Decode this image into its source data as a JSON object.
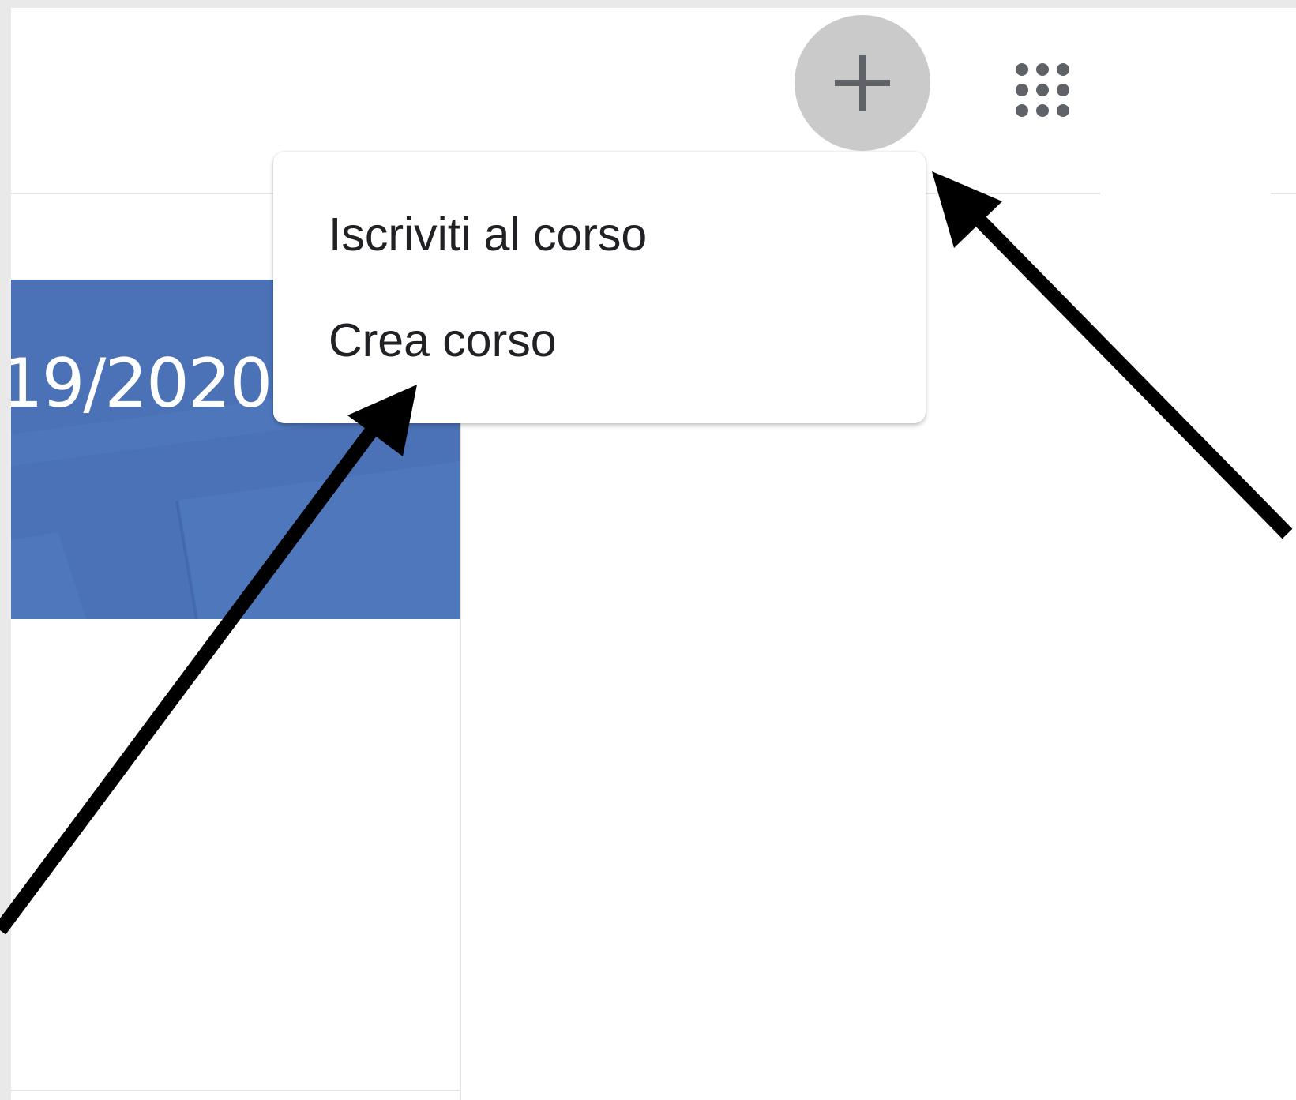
{
  "header": {
    "add_button": {
      "icon": "plus-icon"
    },
    "apps_button": {
      "icon": "apps-grid-icon"
    }
  },
  "course_card": {
    "title": "19/2020",
    "banner_color": "#4b72b7"
  },
  "menu": {
    "items": [
      {
        "label": "Iscriviti al corso"
      },
      {
        "label": "Crea corso"
      }
    ]
  },
  "colors": {
    "page_background": "#ffffff",
    "outer_background": "#e9e9ea",
    "add_button_background": "#cacaca",
    "icon_color": "#5f6368",
    "annotation_arrow": "#000000"
  }
}
